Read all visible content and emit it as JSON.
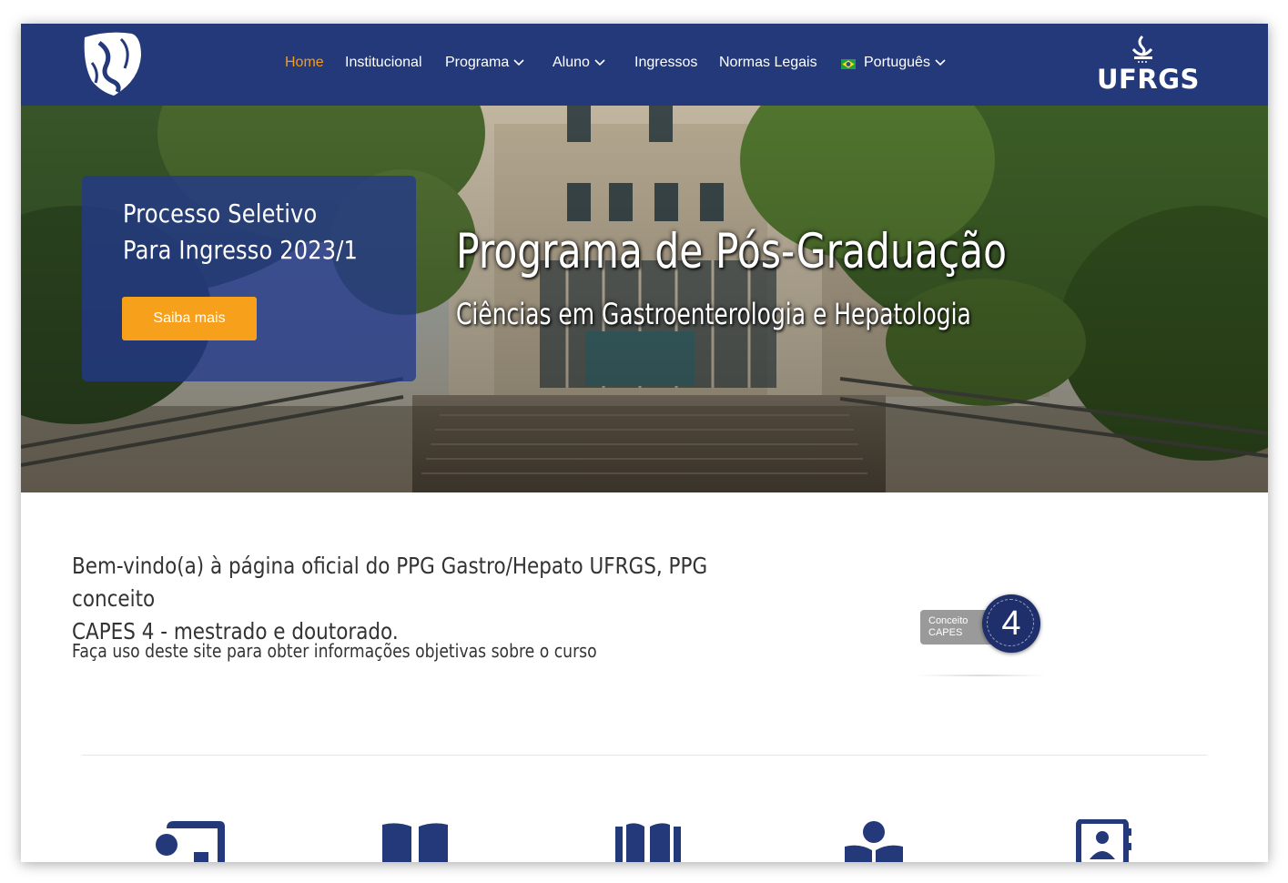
{
  "nav": {
    "items": [
      {
        "label": "Home",
        "active": true
      },
      {
        "label": "Institucional"
      },
      {
        "label": "Programa",
        "dropdown": true
      },
      {
        "label": "Aluno",
        "dropdown": true
      },
      {
        "label": "Ingressos"
      },
      {
        "label": "Normas Legais"
      },
      {
        "label": "Português",
        "dropdown": true,
        "flag": "brazil-flag-icon"
      }
    ],
    "brand_right": "UFRGS"
  },
  "hero": {
    "promo": {
      "title_line1": "Processo Seletivo",
      "title_line2": "Para Ingresso 2023/1",
      "button_label": "Saiba mais"
    },
    "title": "Programa de Pós-Graduação",
    "subtitle": "Ciências em Gastroenterologia e Hepatologia"
  },
  "welcome": {
    "heading_line1": "Bem-vindo(a) à página oficial do PPG Gastro/Hepato UFRGS, PPG conceito",
    "heading_line2": "CAPES 4 - mestrado e doutorado.",
    "subtext": "Faça uso deste site para obter informações objetivas sobre o curso"
  },
  "capes_badge": {
    "label_line1": "Conceito",
    "label_line2": "CAPES",
    "value": "4"
  },
  "feature_icons": [
    "teacher-board-icon",
    "open-book-icon",
    "books-icon",
    "reader-icon",
    "contact-book-icon"
  ],
  "colors": {
    "navbar": "#233979",
    "accent_orange": "#f7a01c",
    "active_nav": "#f39c1c",
    "icon_blue": "#233979"
  }
}
